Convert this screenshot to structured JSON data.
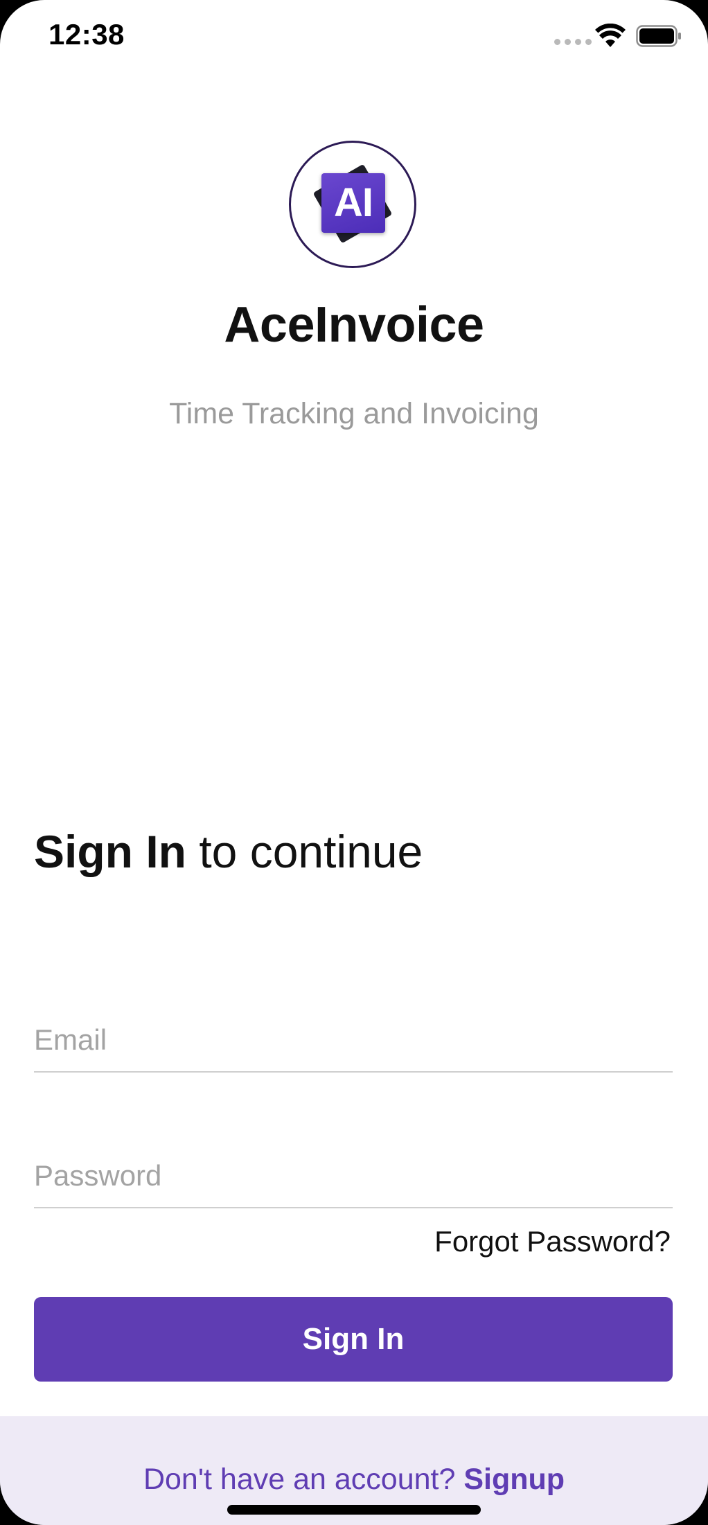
{
  "status_bar": {
    "time": "12:38"
  },
  "app": {
    "logo_text": "AI",
    "title": "AceInvoice",
    "subtitle": "Time Tracking and Invoicing"
  },
  "signin": {
    "heading_bold": "Sign In",
    "heading_rest": " to continue",
    "email_placeholder": "Email",
    "password_placeholder": "Password",
    "forgot_label": "Forgot Password?",
    "button_label": "Sign In"
  },
  "footer": {
    "prompt": "Don't have an account? ",
    "signup_label": "Signup"
  },
  "colors": {
    "brand": "#5f3db3",
    "footer_bg": "#eeeaf6"
  }
}
